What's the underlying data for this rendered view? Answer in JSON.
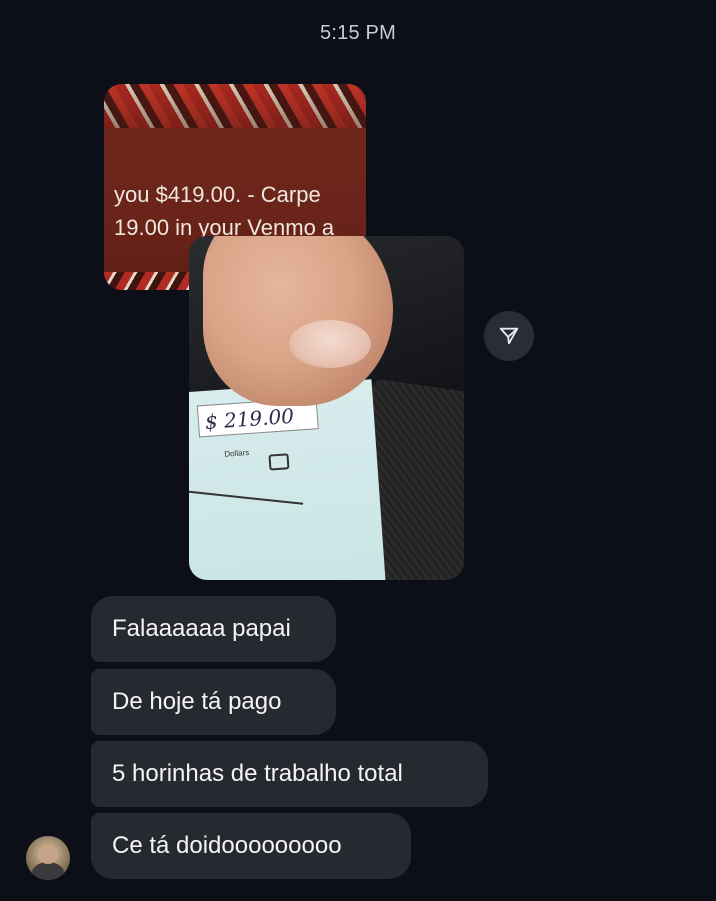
{
  "header": {
    "timestamp": "5:15 PM"
  },
  "shared_photos": [
    {
      "kind": "venmo-screenshot",
      "lines": [
        "you $419.00. - Carpe",
        "19.00 in your Venmo a"
      ]
    },
    {
      "kind": "check-photo",
      "amount_text": "$ 219.00",
      "check_label": "Dollars"
    }
  ],
  "share_button": {
    "icon": "paper-plane-icon"
  },
  "messages": [
    {
      "text": "Falaaaaaa papai"
    },
    {
      "text": "De hoje tá pago"
    },
    {
      "text": "5 horinhas de trabalho total"
    },
    {
      "text": "Ce tá doidooooooooo"
    }
  ],
  "colors": {
    "background": "#0c0f18",
    "bubble": "#262930",
    "text": "#f4f4f6",
    "timestamp": "#c9ccd3"
  }
}
